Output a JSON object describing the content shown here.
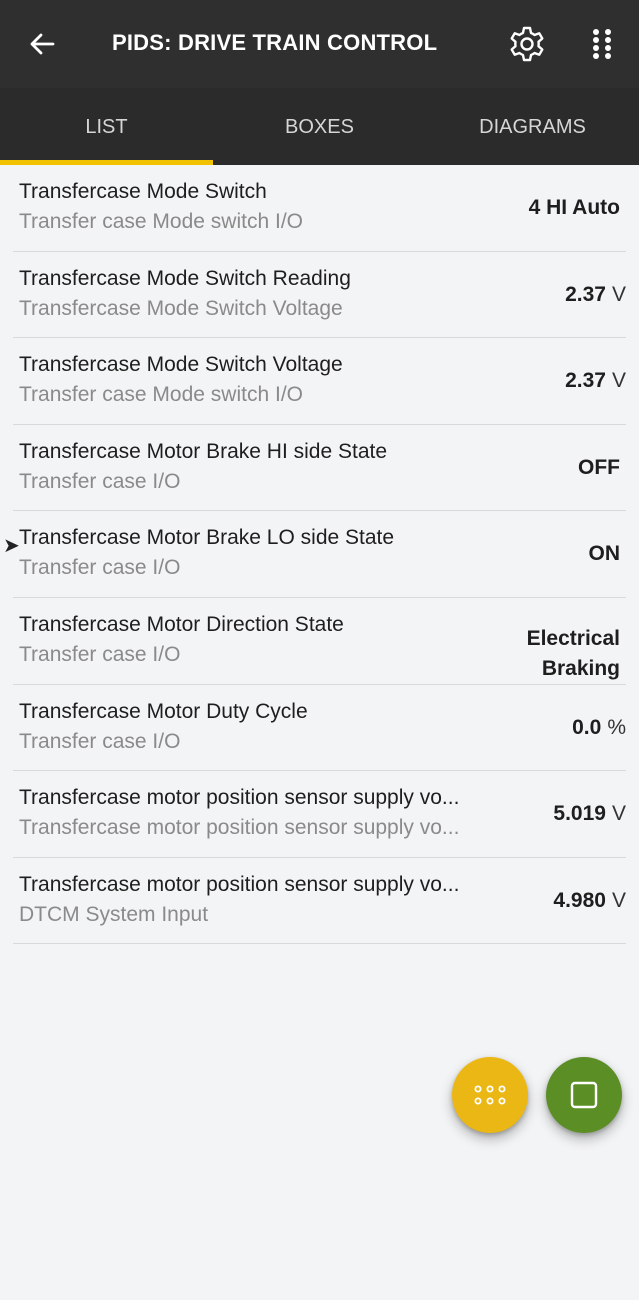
{
  "header": {
    "title": "PIDS: DRIVE TRAIN CONTROL",
    "back_icon": "arrow-left-icon",
    "settings_icon": "gear-icon",
    "more_icon": "grid-dots-icon"
  },
  "tabs": [
    {
      "label": "LIST",
      "active": true
    },
    {
      "label": "BOXES",
      "active": false
    },
    {
      "label": "DIAGRAMS",
      "active": false
    }
  ],
  "accent_color": "#f2c200",
  "pids": [
    {
      "name": "Transfercase Mode Switch",
      "sub": "Transfer case Mode switch I/O",
      "value": "4 HI Auto",
      "unit": ""
    },
    {
      "name": "Transfercase Mode Switch Reading",
      "sub": "Transfercase Mode Switch Voltage",
      "value": "2.37",
      "unit": "V"
    },
    {
      "name": "Transfercase Mode Switch Voltage",
      "sub": "Transfer case Mode switch I/O",
      "value": "2.37",
      "unit": "V"
    },
    {
      "name": "Transfercase Motor Brake HI side State",
      "sub": "Transfer case I/O",
      "value": "OFF",
      "unit": ""
    },
    {
      "name": "Transfercase Motor Brake LO side State",
      "sub": "Transfer case I/O",
      "value": "ON",
      "unit": "",
      "marker": "➤"
    },
    {
      "name": "Transfercase Motor Direction State",
      "sub": "Transfer case I/O",
      "value": "Electrical",
      "value2": "Braking",
      "unit": ""
    },
    {
      "name": "Transfercase Motor Duty Cycle",
      "sub": "Transfer case I/O",
      "value": "0.0",
      "unit": "%"
    },
    {
      "name": "Transfercase motor position sensor supply vo...",
      "sub": "Transfercase motor position sensor supply vo...",
      "value": "5.019",
      "unit": "V"
    },
    {
      "name": "Transfercase motor position sensor supply vo...",
      "sub": "DTCM System Input",
      "value": "4.980",
      "unit": "V"
    }
  ],
  "fabs": {
    "menu_icon": "dots-grid-icon",
    "menu_color": "#ebb714",
    "stop_icon": "square-icon",
    "stop_color": "#5b8f26"
  }
}
